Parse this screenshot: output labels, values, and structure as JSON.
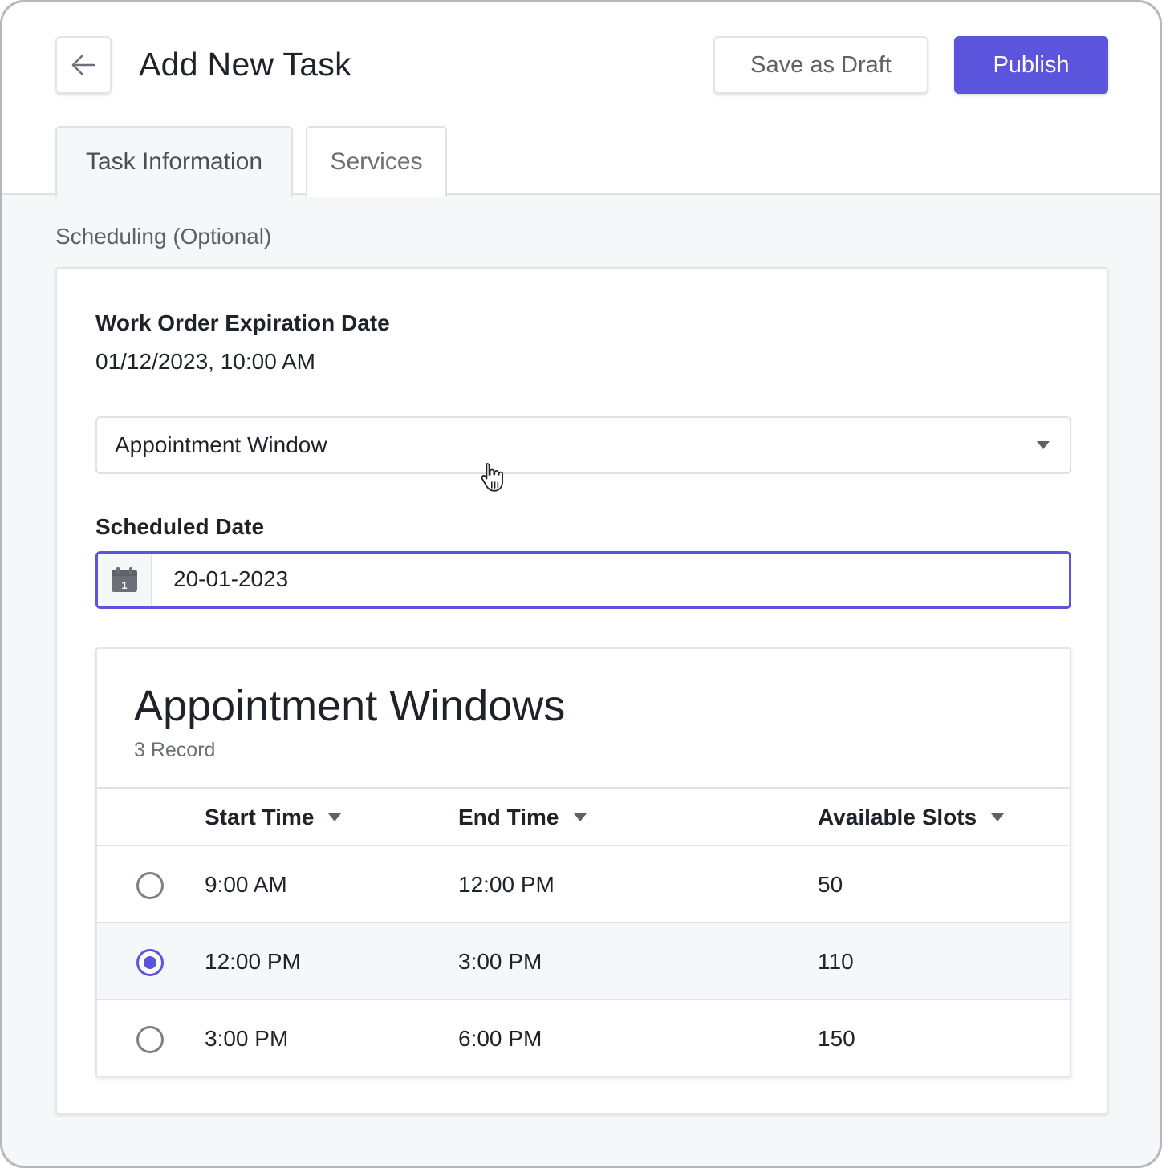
{
  "header": {
    "title": "Add New Task",
    "save_draft_label": "Save as Draft",
    "publish_label": "Publish",
    "back_icon": "arrow-left-icon"
  },
  "tabs": [
    {
      "label": "Task Information",
      "active": true
    },
    {
      "label": "Services",
      "active": false
    }
  ],
  "scheduling": {
    "section_label": "Scheduling (Optional)",
    "expiration_label": "Work Order Expiration Date",
    "expiration_value": "01/12/2023, 10:00 AM",
    "schedule_type": "Appointment Window",
    "scheduled_date_label": "Scheduled Date",
    "scheduled_date_value": "20-01-2023",
    "calendar_icon_day": "1"
  },
  "appointment_windows": {
    "title": "Appointment Windows",
    "count": "3 Record",
    "columns": [
      "Start Time",
      "End Time",
      "Available Slots"
    ],
    "rows": [
      {
        "start": "9:00 AM",
        "end": "12:00 PM",
        "slots": "50",
        "selected": false
      },
      {
        "start": "12:00 PM",
        "end": "3:00 PM",
        "slots": "110",
        "selected": true
      },
      {
        "start": "3:00 PM",
        "end": "6:00 PM",
        "slots": "150",
        "selected": false
      }
    ]
  },
  "colors": {
    "accent": "#5b55dd",
    "border": "#dfe1e5",
    "background": "#f6f7f9"
  }
}
